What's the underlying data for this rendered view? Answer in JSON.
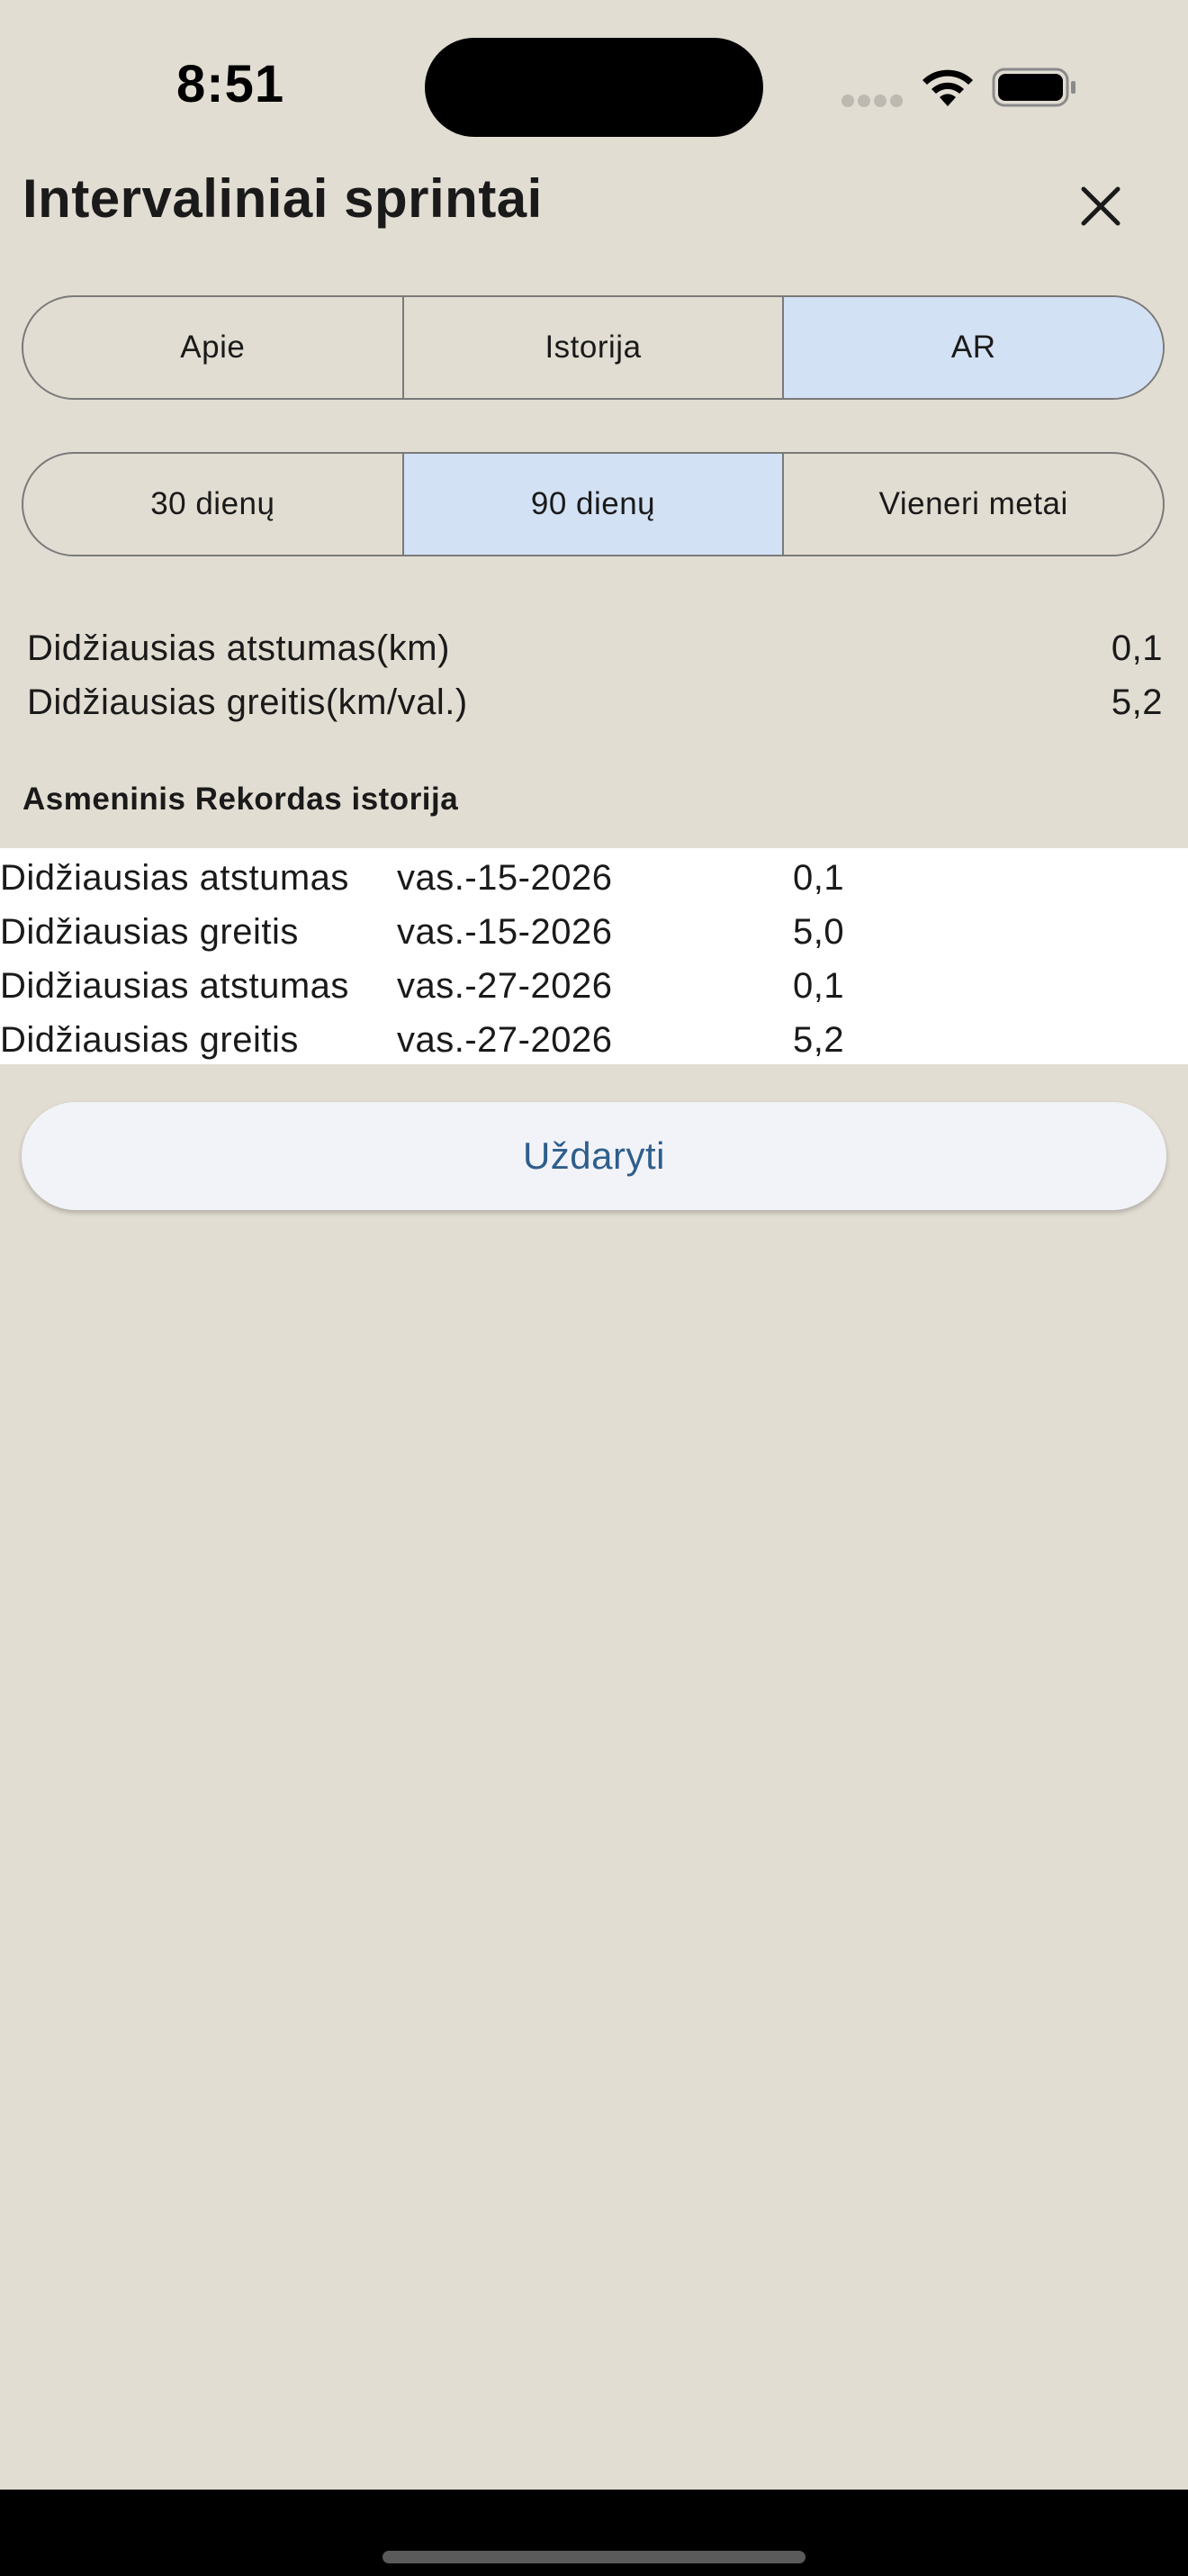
{
  "status_bar": {
    "time": "8:51"
  },
  "header": {
    "title": "Intervaliniai sprintai",
    "close_icon": "close-x-icon"
  },
  "tabs": [
    {
      "label": "Apie",
      "selected": false
    },
    {
      "label": "Istorija",
      "selected": false
    },
    {
      "label": "AR",
      "selected": true
    }
  ],
  "ranges": [
    {
      "label": "30 dienų",
      "selected": false
    },
    {
      "label": "90 dienų",
      "selected": true
    },
    {
      "label": "Vieneri metai",
      "selected": false
    }
  ],
  "summary": [
    {
      "label": "Didžiausias atstumas(km)",
      "value": "0,1"
    },
    {
      "label": "Didžiausias greitis(km/val.)",
      "value": "5,2"
    }
  ],
  "history": {
    "heading": "Asmeninis Rekordas istorija",
    "rows": [
      {
        "name": "Didžiausias atstumas",
        "date": "vas.-15-2026",
        "value": "0,1"
      },
      {
        "name": "Didžiausias greitis",
        "date": "vas.-15-2026",
        "value": "5,0"
      },
      {
        "name": "Didžiausias atstumas",
        "date": "vas.-27-2026",
        "value": "0,1"
      },
      {
        "name": "Didžiausias greitis",
        "date": "vas.-27-2026",
        "value": "5,2"
      }
    ]
  },
  "dismiss_button": {
    "label": "Uždaryti"
  },
  "colors": {
    "background": "#e2ddd2",
    "selected_segment": "#d3e1f4",
    "accent_text": "#2e5e8c"
  }
}
